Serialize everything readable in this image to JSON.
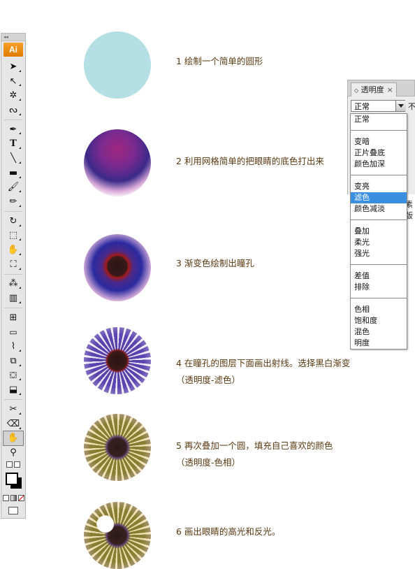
{
  "toolbar": {
    "logo": "Ai",
    "tools": [
      "selection",
      "direct-selection",
      "magic-wand",
      "lasso",
      "pen",
      "type",
      "line-segment",
      "rectangle",
      "paintbrush",
      "pencil",
      "rotate",
      "scale",
      "warp",
      "free-transform",
      "symbol-sprayer",
      "column-graph",
      "mesh",
      "gradient",
      "eyedropper",
      "blend",
      "live-paint-bucket",
      "live-paint-selection",
      "slice",
      "eraser",
      "hand",
      "zoom"
    ]
  },
  "steps": [
    {
      "text": "1 绘制一个简单的圆形"
    },
    {
      "text": "2 利用网格简单的把眼睛的底色打出来"
    },
    {
      "text": "3 渐变色绘制出瞳孔"
    },
    {
      "text": "4 在瞳孔的图层下面画出射线。选择黑白渐变",
      "text2": "（透明度-滤色）"
    },
    {
      "text": "5 再次叠加一个圆，填充自己喜欢的颜色",
      "text2": "（透明度-色相）"
    },
    {
      "text": "6 画出眼睛的高光和反光。"
    }
  ],
  "panel": {
    "tab_label": "透明度",
    "close": "×",
    "blend_mode": "正常",
    "opacity_label_partial": "不",
    "side_text_partial": "素版"
  },
  "dropdown": {
    "groups": [
      [
        "正常"
      ],
      [
        "变暗",
        "正片叠底",
        "颜色加深"
      ],
      [
        "变亮",
        "滤色",
        "颜色减淡"
      ],
      [
        "叠加",
        "柔光",
        "强光"
      ],
      [
        "差值",
        "排除"
      ],
      [
        "色相",
        "饱和度",
        "混色",
        "明度"
      ]
    ],
    "highlighted": "滤色"
  },
  "colors": {
    "step_text": "#5b3a12",
    "highlight": "#3b8fe0",
    "logo": "#f29b1e"
  }
}
